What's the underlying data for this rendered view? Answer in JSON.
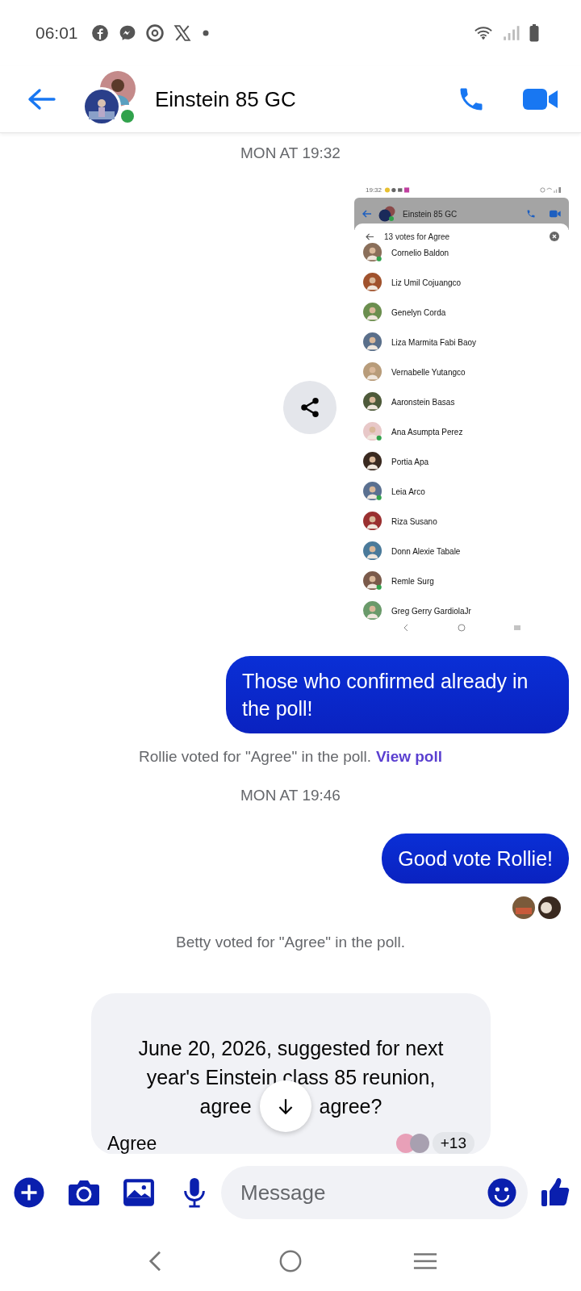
{
  "status_bar": {
    "time": "06:01"
  },
  "header": {
    "title": "Einstein 85 GC",
    "online": true
  },
  "messages": [
    {
      "kind": "timestamp",
      "text": "MON AT 19:32"
    },
    {
      "kind": "image",
      "screenshot": {
        "status_time": "19:32",
        "title": "Einstein 85 GC",
        "online": true,
        "sheet_title": "13 votes for Agree",
        "voters": [
          {
            "name": "Cornelio Baldon",
            "online": true
          },
          {
            "name": "Liz Umil Cojuangco",
            "online": false
          },
          {
            "name": "Genelyn Corda",
            "online": false
          },
          {
            "name": "Liza Marmita Fabi Baoy",
            "online": false
          },
          {
            "name": "Vernabelle Yutangco",
            "online": false
          },
          {
            "name": "Aaronstein Basas",
            "online": false
          },
          {
            "name": "Ana Asumpta Perez",
            "online": true
          },
          {
            "name": "Portia Apa",
            "online": false
          },
          {
            "name": "Leia Arco",
            "online": true
          },
          {
            "name": "Riza Susano",
            "online": false
          },
          {
            "name": "Donn Alexie Tabale",
            "online": false
          },
          {
            "name": "Remle Surg",
            "online": true
          },
          {
            "name": "Greg Gerry GardiolaJr",
            "online": false
          }
        ]
      }
    },
    {
      "kind": "sent",
      "text": "Those who confirmed already in the poll!"
    },
    {
      "kind": "system",
      "text": "Rollie voted for \"Agree\" in the poll.",
      "link": "View poll"
    },
    {
      "kind": "timestamp",
      "text": "MON AT 19:46"
    },
    {
      "kind": "sent",
      "text": "Good vote Rollie!",
      "seen": true
    },
    {
      "kind": "system",
      "text": "Betty voted for \"Agree\" in the poll."
    },
    {
      "kind": "poll",
      "question": "June 20, 2026, suggested for next year's Einstein class 85 reunion,",
      "question_visible_end": [
        "agree",
        "agree?"
      ],
      "options": [
        {
          "label": "Agree",
          "count": "+13"
        }
      ]
    }
  ],
  "composer": {
    "placeholder": "Message"
  }
}
